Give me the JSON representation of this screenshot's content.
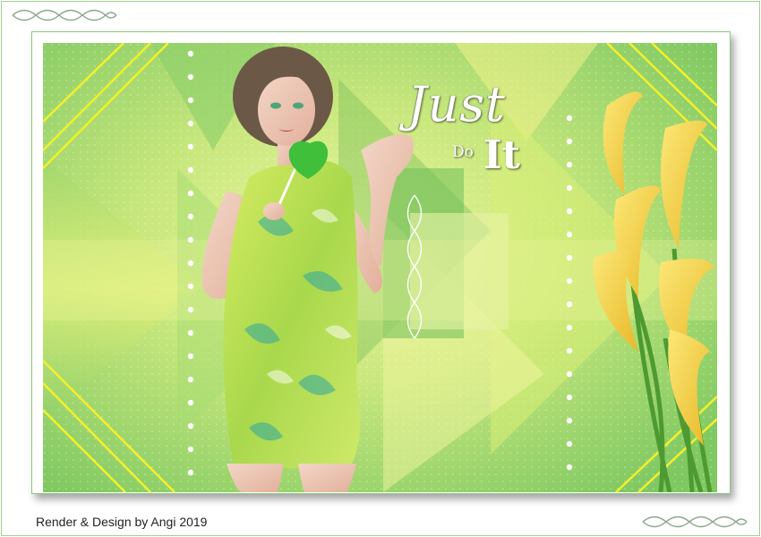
{
  "artwork": {
    "title_word_1": "Just",
    "title_word_2": "Do",
    "title_word_3": "It",
    "description_colors": {
      "background_green": "#8ed36a",
      "light_green": "#c8ea7a",
      "yellow": "#f2f14a",
      "flower_yellow": "#f6d74a",
      "dress_green": "#b9dc4c",
      "lollipop": "#3fbf3a"
    }
  },
  "footer": {
    "credit": "Render & Design by Angi 2019"
  }
}
